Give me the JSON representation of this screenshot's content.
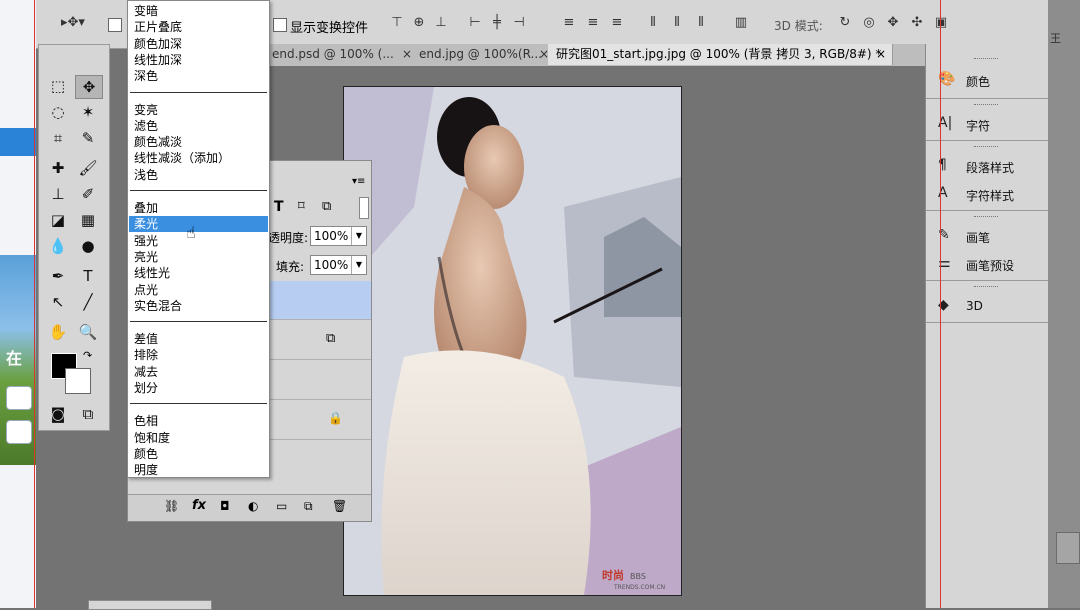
{
  "options_bar": {
    "show_transform_label": "显示变换控件",
    "mode_3d_label": "3D 模式:"
  },
  "tabs": [
    {
      "label": "end.psd @ 100% (..."
    },
    {
      "label": "end.jpg @ 100%(R..."
    },
    {
      "label": "研究图01_start.jpg.jpg @ 100% (背景 拷贝 3, RGB/8#) *",
      "active": true
    }
  ],
  "blend_modes": {
    "groups": [
      [
        "变暗",
        "正片叠底",
        "颜色加深",
        "线性加深",
        "深色"
      ],
      [
        "变亮",
        "滤色",
        "颜色减淡",
        "线性减淡（添加）",
        "浅色"
      ],
      [
        "叠加",
        "柔光",
        "强光",
        "亮光",
        "线性光",
        "点光",
        "实色混合"
      ],
      [
        "差值",
        "排除",
        "减去",
        "划分"
      ],
      [
        "色相",
        "饱和度",
        "颜色",
        "明度"
      ]
    ],
    "highlighted": "柔光"
  },
  "layers_panel": {
    "opacity_label": "透明度:",
    "opacity_value": "100%",
    "fill_label": "填充:",
    "fill_value": "100%"
  },
  "right_panels": [
    {
      "label": "颜色",
      "icon": "palette-icon"
    },
    {
      "label": "字符",
      "icon": "character-icon"
    },
    {
      "label": "段落样式",
      "icon": "paragraph-style-icon"
    },
    {
      "label": "字符样式",
      "icon": "character-style-icon"
    },
    {
      "label": "画笔",
      "icon": "brush-icon"
    },
    {
      "label": "画笔预设",
      "icon": "brush-preset-icon"
    },
    {
      "label": "3D",
      "icon": "cube-icon"
    }
  ],
  "desktop": {
    "left_tag": "在",
    "right_text": "王"
  },
  "canvas": {
    "watermark": "时尚",
    "watermark_sub": "BBS",
    "watermark_url": "TRENDS.COM.CN"
  },
  "colors": {
    "highlight": "#3a8fe0",
    "selected_layer": "#b7cdf2",
    "guide_red": "#d33333"
  }
}
